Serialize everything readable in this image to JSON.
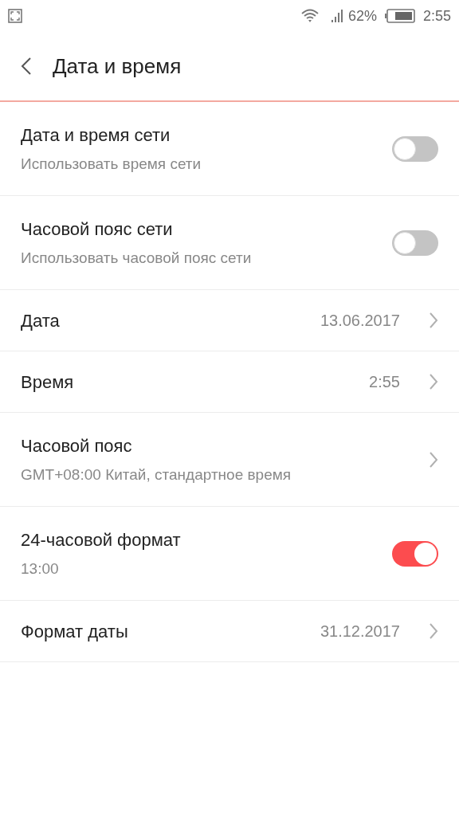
{
  "status_bar": {
    "battery": "62%",
    "time": "2:55"
  },
  "header": {
    "title": "Дата и время"
  },
  "rows": [
    {
      "kind": "toggle",
      "title": "Дата и время сети",
      "subtitle": "Использовать время сети",
      "on": false
    },
    {
      "kind": "toggle",
      "title": "Часовой пояс сети",
      "subtitle": "Использовать часовой пояс сети",
      "on": false
    },
    {
      "kind": "link",
      "title": "Дата",
      "value": "13.06.2017"
    },
    {
      "kind": "link",
      "title": "Время",
      "value": "2:55"
    },
    {
      "kind": "link",
      "title": "Часовой пояс",
      "subtitle": "GMT+08:00 Китай, стандартное время"
    },
    {
      "kind": "toggle",
      "title": "24-часовой формат",
      "subtitle": "13:00",
      "on": true
    },
    {
      "kind": "link",
      "title": "Формат даты",
      "value": "31.12.2017"
    }
  ]
}
